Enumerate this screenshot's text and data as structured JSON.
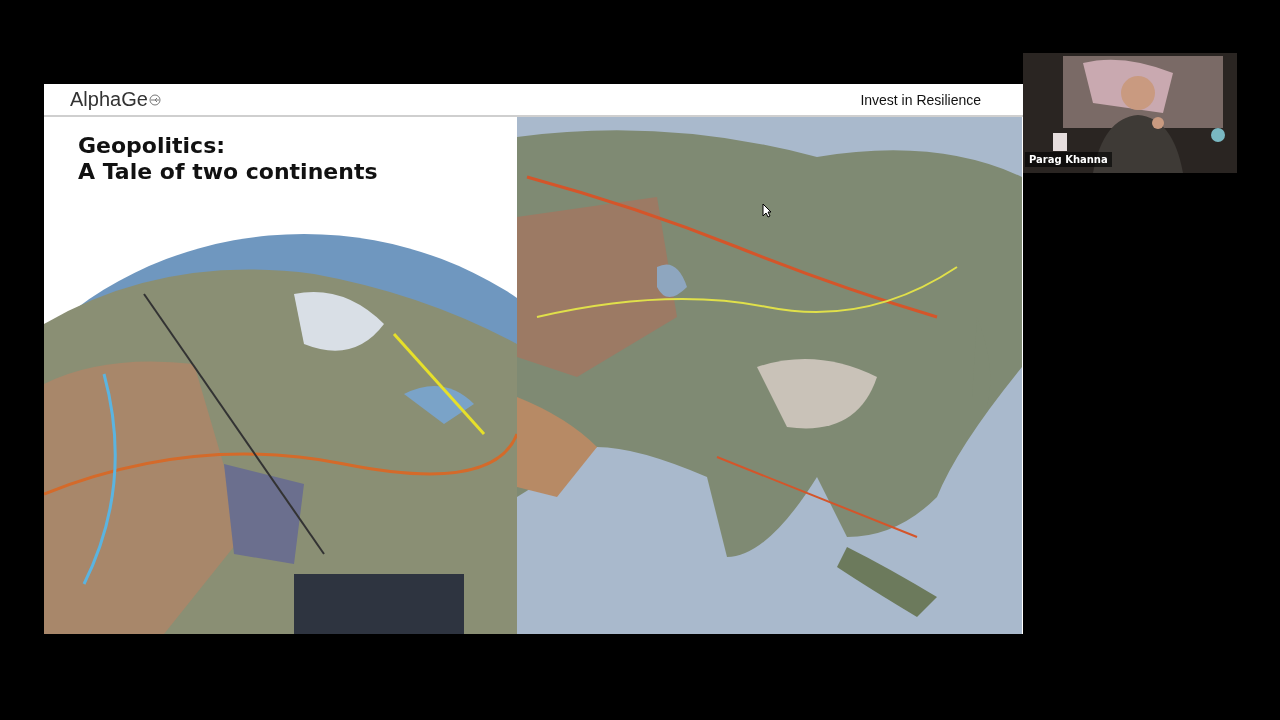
{
  "slide": {
    "logo": "AlphaGe",
    "tagline": "Invest in Resilience",
    "title": "Geopolitics:\nA Tale of two continents"
  },
  "video_tile": {
    "name": "Parag Khanna"
  }
}
